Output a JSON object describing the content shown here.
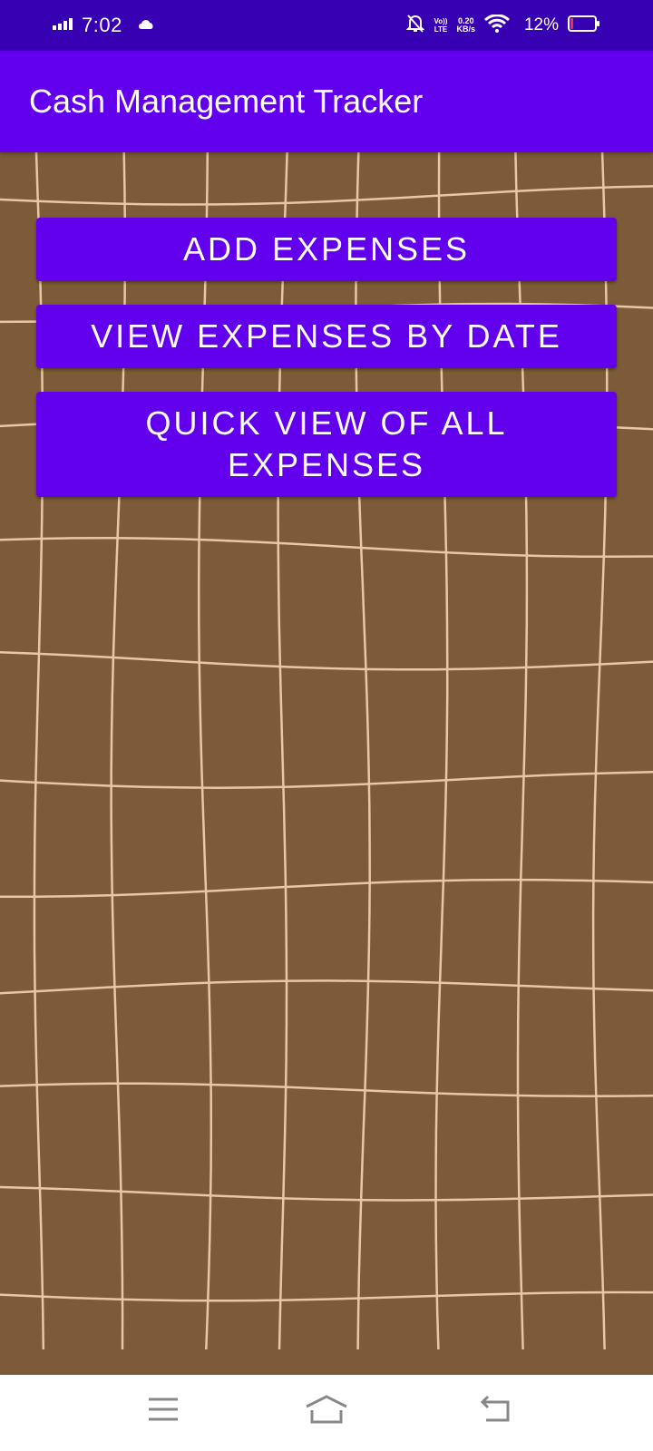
{
  "status_bar": {
    "time": "7:02",
    "net_speed_value": "0.20",
    "net_speed_unit": "KB/s",
    "volte_top": "Vo))",
    "volte_bottom": "LTE",
    "battery_percent": "12%",
    "battery_level": 0.12,
    "icons": [
      "signal-icon",
      "cloud-icon",
      "mute-bell-icon",
      "volte-icon",
      "wifi-icon",
      "battery-icon"
    ]
  },
  "app_bar": {
    "title": "Cash Management Tracker"
  },
  "main": {
    "buttons": {
      "add_expenses": "ADD EXPENSES",
      "view_by_date": "VIEW EXPENSES BY DATE",
      "quick_view": "QUICK VIEW OF ALL EXPENSES"
    }
  },
  "nav_bar": {
    "icons": [
      "menu-icon",
      "home-icon",
      "back-icon"
    ]
  },
  "colors": {
    "status_bar": "#3700b3",
    "primary": "#6200ee",
    "background": "#7d5a38",
    "grid_lines": "#f3d3b0",
    "nav_bar": "#ffffff",
    "battery_low": "#e53935"
  }
}
